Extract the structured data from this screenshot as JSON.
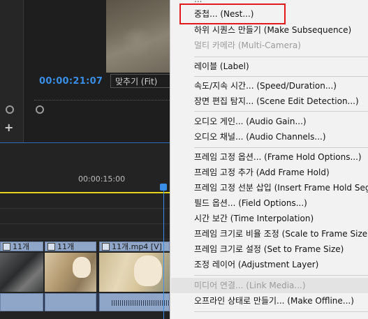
{
  "monitor": {
    "timecode": "00:00:21:07",
    "fit_label": "맞추기 (Fit)"
  },
  "timeline": {
    "ruler_time": "00:00:15:00",
    "clips": [
      {
        "label": "11개"
      },
      {
        "label": "11개"
      },
      {
        "label": "11개.mp4 [V]"
      }
    ]
  },
  "context_menu": {
    "top_partial": "...",
    "items": [
      {
        "label": "중첩... (Nest...)",
        "disabled": false,
        "highlighted": true
      },
      {
        "label": "하위 시퀀스 만들기 (Make Subsequence)",
        "disabled": false
      },
      {
        "label": "멀티 카메라 (Multi-Camera)",
        "disabled": true
      },
      {
        "label": "레이블 (Label)",
        "disabled": false
      },
      {
        "label": "속도/지속 시간... (Speed/Duration...)",
        "disabled": false
      },
      {
        "label": "장면 편집 탐지... (Scene Edit Detection...)",
        "disabled": false
      },
      {
        "label": "오디오 게인... (Audio Gain...)",
        "disabled": false
      },
      {
        "label": "오디오 채널... (Audio Channels...)",
        "disabled": false
      },
      {
        "label": "프레임 고정 옵션... (Frame Hold Options...)",
        "disabled": false
      },
      {
        "label": "프레임 고정 추가 (Add Frame Hold)",
        "disabled": false
      },
      {
        "label": "프레임 고정 선분 삽입 (Insert Frame Hold Seg",
        "disabled": false
      },
      {
        "label": "필드 옵션... (Field Options...)",
        "disabled": false
      },
      {
        "label": "시간 보간 (Time Interpolation)",
        "disabled": false
      },
      {
        "label": "프레임 크기로 비율 조정 (Scale to Frame Size)",
        "disabled": false
      },
      {
        "label": "프레임 크기로 설정 (Set to Frame Size)",
        "disabled": false
      },
      {
        "label": "조정 레이어 (Adjustment Layer)",
        "disabled": false
      },
      {
        "label": "미디어 연결... (Link Media...)",
        "disabled": true
      },
      {
        "label": "오프라인 상태로 만들기... (Make Offline...)",
        "disabled": false
      }
    ]
  },
  "colors": {
    "timecode": "#3a8ee6",
    "playhead": "#3a8ee6",
    "ruler_line": "#e5d21a",
    "highlight_box": "#e21a1a",
    "clip": "#8fa6c9"
  }
}
